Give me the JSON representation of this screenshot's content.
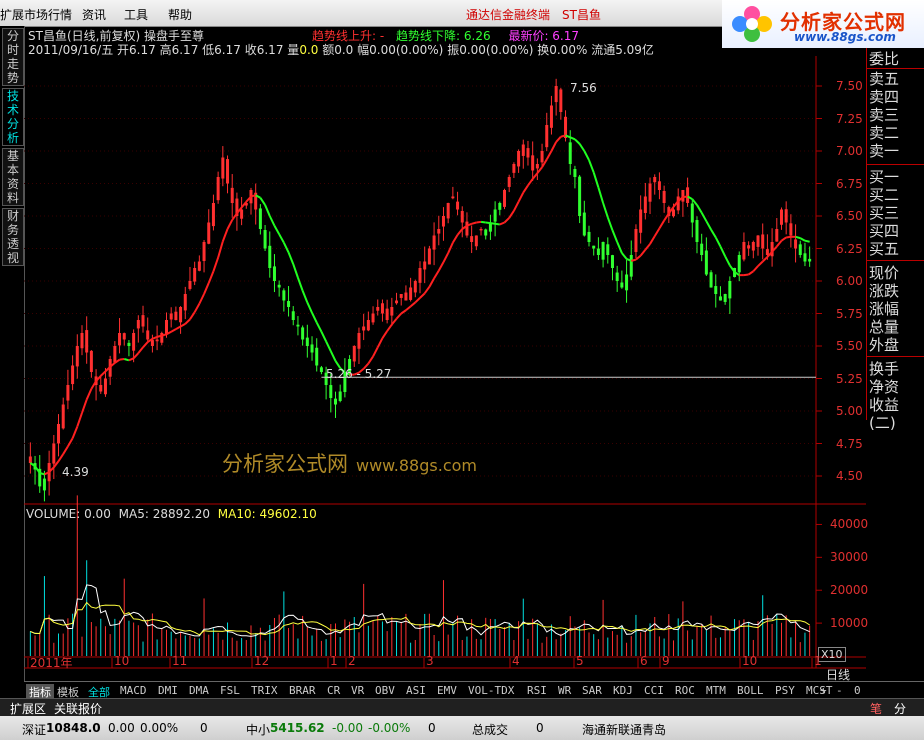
{
  "menu": {
    "items": [
      "扩展市场行情",
      "资讯",
      "工具",
      "帮助"
    ],
    "title": "通达信金融终端",
    "stock": "ST昌鱼"
  },
  "logo": {
    "name": "分析家公式网",
    "url": "www.88gs.com"
  },
  "left_tabs": [
    "分时走势",
    "技术分析",
    "基本资料",
    "财务透视"
  ],
  "header": {
    "title": "ST昌鱼(日线,前复权) 操盘手至尊",
    "trend_up_label": "趋势线上升: -",
    "trend_down_label": "趋势线下降: 6.26",
    "latest_label": "最新价: 6.17",
    "date": "2011/09/16/五",
    "open": "开6.17",
    "high": "高6.17",
    "low": "低6.17",
    "close": "收6.17",
    "volume_label": "量",
    "volume_value": "0.0",
    "amount": "额0.0",
    "change": "幅0.00(0.00%)",
    "amplitude": "振0.00(0.00%)",
    "turnover": "换0.00%",
    "float": "流通5.09亿"
  },
  "annotations": {
    "high_label": "7.56",
    "low_label": "4.39",
    "mid_label": "5.26 - 5.27"
  },
  "price_axis": [
    "7.50",
    "7.25",
    "7.00",
    "6.75",
    "6.50",
    "6.25",
    "6.00",
    "5.75",
    "5.50",
    "5.25",
    "5.00",
    "4.75",
    "4.50"
  ],
  "volume_axis": [
    "40000",
    "30000",
    "20000",
    "10000"
  ],
  "volume_info": {
    "vol": "VOLUME: 0.00",
    "ma5": "MA5: 28892.20",
    "ma10": "MA10: 49602.10"
  },
  "volume_scale": "X10",
  "order_book": [
    "委比",
    "卖五",
    "卖四",
    "卖三",
    "卖二",
    "卖一",
    "买一",
    "买二",
    "买三",
    "买四",
    "买五",
    "现价",
    "涨跌",
    "涨幅",
    "总量",
    "外盘",
    "换手",
    "净资",
    "收益(二)"
  ],
  "month_labels": [
    "2011年",
    "10",
    "11",
    "12",
    "1",
    "2",
    "3",
    "4",
    "5",
    "6",
    "9",
    "10",
    "1"
  ],
  "period": "日线",
  "tabbar": {
    "tabs": [
      "指标",
      "模板",
      "全部"
    ],
    "indicators": [
      "MACD",
      "DMI",
      "DMA",
      "FSL",
      "TRIX",
      "BRAR",
      "CR",
      "VR",
      "OBV",
      "ASI",
      "EMV",
      "VOL-TDX",
      "RSI",
      "WR",
      "SAR",
      "KDJ",
      "CCI",
      "ROC",
      "MTM",
      "BOLL",
      "PSY",
      "MCST"
    ],
    "controls": [
      "+",
      "-",
      "0"
    ]
  },
  "expand": {
    "labels": [
      "扩展区",
      "关联报价"
    ],
    "right": [
      "笔",
      "分"
    ]
  },
  "status": {
    "sz_label": "深证",
    "sz_value": "10848.0",
    "sz_change": "0.00",
    "sz_pct": "0.00%",
    "sz_vol": "0",
    "zx_label": "中小",
    "zx_value": "5415.62",
    "zx_change": "-0.00",
    "zx_pct": "-0.00%",
    "zx_vol": "0",
    "total_label": "总成交",
    "total_value": "0",
    "broker": "海通新联通青岛"
  },
  "watermark": {
    "text": "分析家公式网",
    "url": "www.88gs.com"
  },
  "colors": {
    "up": "#ff3030",
    "down": "#30ff30",
    "axis": "#b00000",
    "ma_up": "#ff2020",
    "ma_down": "#20ff20"
  },
  "chart_data": {
    "type": "candlestick",
    "price_range": [
      4.3,
      7.7
    ],
    "volume_range": [
      0,
      45000
    ],
    "closes": [
      4.6,
      4.55,
      4.42,
      4.48,
      4.6,
      4.75,
      4.9,
      5.05,
      5.2,
      5.35,
      5.5,
      5.6,
      5.45,
      5.3,
      5.2,
      5.15,
      5.25,
      5.4,
      5.5,
      5.6,
      5.55,
      5.5,
      5.6,
      5.7,
      5.65,
      5.55,
      5.5,
      5.55,
      5.6,
      5.7,
      5.75,
      5.7,
      5.8,
      5.9,
      6.0,
      6.1,
      6.15,
      6.3,
      6.45,
      6.6,
      6.8,
      6.95,
      6.75,
      6.6,
      6.5,
      6.55,
      6.6,
      6.7,
      6.55,
      6.4,
      6.25,
      6.1,
      6.0,
      5.95,
      5.85,
      5.8,
      5.7,
      5.65,
      5.55,
      5.5,
      5.45,
      5.35,
      5.3,
      5.2,
      5.1,
      5.05,
      5.15,
      5.3,
      5.4,
      5.5,
      5.6,
      5.65,
      5.7,
      5.75,
      5.8,
      5.75,
      5.7,
      5.8,
      5.85,
      5.9,
      5.85,
      5.95,
      6.0,
      6.1,
      6.15,
      6.25,
      6.35,
      6.4,
      6.5,
      6.6,
      6.65,
      6.55,
      6.45,
      6.35,
      6.3,
      6.35,
      6.4,
      6.35,
      6.45,
      6.55,
      6.6,
      6.7,
      6.8,
      6.9,
      7.0,
      7.05,
      6.95,
      6.85,
      6.9,
      7.0,
      7.2,
      7.35,
      7.5,
      7.3,
      7.1,
      6.9,
      6.8,
      6.5,
      6.35,
      6.3,
      6.25,
      6.2,
      6.3,
      6.2,
      6.1,
      6.0,
      5.95,
      6.05,
      6.2,
      6.4,
      6.55,
      6.65,
      6.75,
      6.8,
      6.7,
      6.6,
      6.5,
      6.55,
      6.65,
      6.7,
      6.6,
      6.45,
      6.3,
      6.2,
      6.05,
      5.95,
      5.9,
      5.85,
      5.9,
      6.0,
      6.1,
      6.2,
      6.3,
      6.25,
      6.3,
      6.35,
      6.25,
      6.2,
      6.3,
      6.4,
      6.55,
      6.45,
      6.35,
      6.25,
      6.2,
      6.15,
      6.17
    ]
  }
}
